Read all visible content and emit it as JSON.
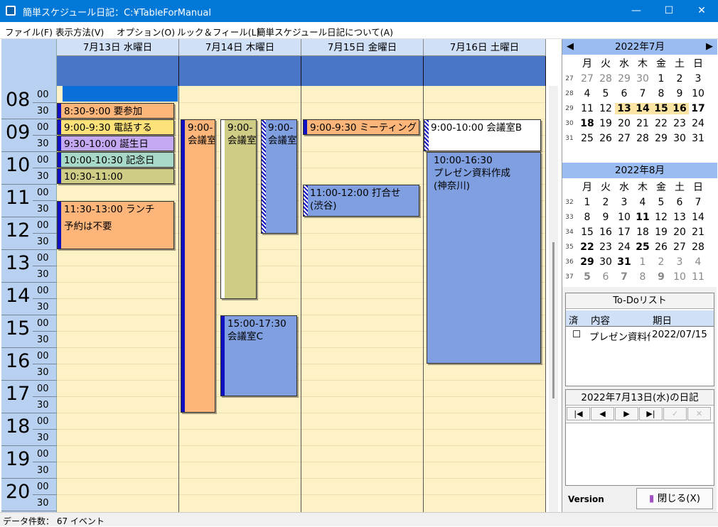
{
  "window": {
    "title": "簡単スケジュール日記：C:¥TableForManual",
    "min": "—",
    "max": "☐",
    "close": "✕"
  },
  "menu": [
    "ファイル(F)",
    "表示方法(V)",
    "オプション(O)",
    "ルック＆フィール(L)",
    "簡単スケジュール日記について(A)"
  ],
  "days": [
    {
      "label": "7月13日 水曜日"
    },
    {
      "label": "7月14日 木曜日"
    },
    {
      "label": "7月15日 金曜日"
    },
    {
      "label": "7月16日 土曜日"
    }
  ],
  "hours": [
    "08",
    "09",
    "10",
    "11",
    "12",
    "13",
    "14",
    "15",
    "16",
    "17",
    "18",
    "19",
    "20"
  ],
  "minutes": [
    "00",
    "30"
  ],
  "events": {
    "d0_a": "8:30-9:00 要参加",
    "d0_b": "9:00-9:30 電話する",
    "d0_c": "9:30-10:00 誕生日",
    "d0_d": "10:00-10:30 記念日",
    "d0_e": "10:30-11:00",
    "d0_f1": "11:30-13:00 ランチ",
    "d0_f2": "予約は不要",
    "d1_a1": "9:00-",
    "d1_a2": "会議室",
    "d1_b1": "9:00-",
    "d1_b2": "会議室",
    "d1_c1": "9:00-",
    "d1_c2": "会議室",
    "d1_d1": "15:00-17:30",
    "d1_d2": "会議室C",
    "d2_a": "9:00-9:30 ミーティング",
    "d2_b1": "11:00-12:00 打合せ",
    "d2_b2": "(渋谷)",
    "d3_a": "9:00-10:00 会議室B",
    "d3_b1": "10:00-16:30",
    "d3_b2": "プレゼン資料作成",
    "d3_b3": "(神奈川)"
  },
  "colors": {
    "orange": "#fdb57a",
    "yellow": "#fde27a",
    "purple": "#c4a8f2",
    "teal": "#a8d8c8",
    "olive": "#cfcc86",
    "blue": "#7f9fe0",
    "white": "#ffffff",
    "grid": "#fdf2c6"
  },
  "july": {
    "title": "2022年7月",
    "prev": "◀",
    "next": "▶",
    "weekdays": [
      "月",
      "火",
      "水",
      "木",
      "金",
      "土",
      "日"
    ],
    "weeks": [
      {
        "wk": "27",
        "days": [
          "27",
          "28",
          "29",
          "30",
          "1",
          "2",
          "3"
        ]
      },
      {
        "wk": "28",
        "days": [
          "4",
          "5",
          "6",
          "7",
          "8",
          "9",
          "10"
        ]
      },
      {
        "wk": "29",
        "days": [
          "11",
          "12",
          "13",
          "14",
          "15",
          "16",
          "17"
        ]
      },
      {
        "wk": "30",
        "days": [
          "18",
          "19",
          "20",
          "21",
          "22",
          "23",
          "24"
        ]
      },
      {
        "wk": "31",
        "days": [
          "25",
          "26",
          "27",
          "28",
          "29",
          "30",
          "31"
        ]
      }
    ]
  },
  "august": {
    "title": "2022年8月",
    "weekdays": [
      "月",
      "火",
      "水",
      "木",
      "金",
      "土",
      "日"
    ],
    "weeks": [
      {
        "wk": "32",
        "days": [
          "1",
          "2",
          "3",
          "4",
          "5",
          "6",
          "7"
        ]
      },
      {
        "wk": "33",
        "days": [
          "8",
          "9",
          "10",
          "11",
          "12",
          "13",
          "14"
        ]
      },
      {
        "wk": "34",
        "days": [
          "15",
          "16",
          "17",
          "18",
          "19",
          "20",
          "21"
        ]
      },
      {
        "wk": "35",
        "days": [
          "22",
          "23",
          "24",
          "25",
          "26",
          "27",
          "28"
        ]
      },
      {
        "wk": "36",
        "days": [
          "29",
          "30",
          "31",
          "1",
          "2",
          "3",
          "4"
        ]
      },
      {
        "wk": "37",
        "days": [
          "5",
          "6",
          "7",
          "8",
          "9",
          "10",
          "11"
        ]
      }
    ]
  },
  "todo": {
    "title": "To-Doリスト",
    "col_done": "済",
    "col_content": "内容",
    "col_due": "期日",
    "rows": [
      {
        "check": "☐",
        "content": "プレゼン資料作",
        "due": "2022/07/15"
      }
    ]
  },
  "diary": {
    "title": "2022年7月13日(水)の日記",
    "first": "|◀",
    "prev": "◀",
    "next": "▶",
    "last": "▶|"
  },
  "footer": {
    "version": "Version",
    "close": "閉じる(X)"
  },
  "status": "データ件数： 67 イベント"
}
